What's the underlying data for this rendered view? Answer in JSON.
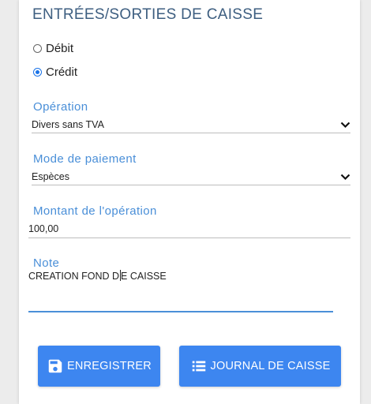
{
  "form": {
    "title": "ENTRÉES/SORTIES DE CAISSE",
    "type_options": [
      {
        "label": "Débit",
        "checked": false
      },
      {
        "label": "Crédit",
        "checked": true
      }
    ],
    "operation": {
      "label": "Opération",
      "value": "Divers sans TVA"
    },
    "payment_mode": {
      "label": "Mode de paiement",
      "value": "Espèces"
    },
    "amount": {
      "label": "Montant de l'opération",
      "value": "100,00"
    },
    "note": {
      "label": "Note",
      "value_before_cursor": "CREATION FOND D",
      "value_after_cursor": "E CAISSE"
    }
  },
  "buttons": {
    "save": {
      "label": "ENREGISTRER",
      "icon": "floppy-disk-icon"
    },
    "journal": {
      "label": "JOURNAL DE CAISSE",
      "icon": "list-icon"
    }
  },
  "colors": {
    "accent": "#4a8fd8",
    "button": "#3d86f0",
    "title": "#3d5e80"
  }
}
